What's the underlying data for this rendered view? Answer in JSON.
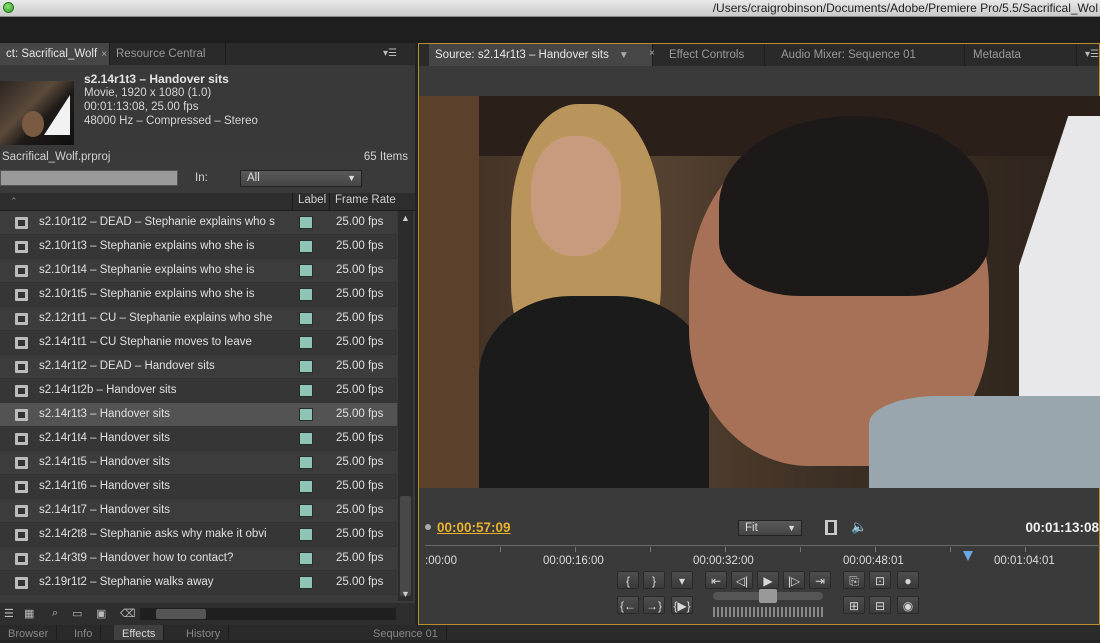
{
  "window": {
    "path": "/Users/craigrobinson/Documents/Adobe/Premiere Pro/5.5/Sacrifical_Wol"
  },
  "project_panel": {
    "tabs": [
      {
        "label": "ct: Sacrifical_Wolf",
        "active": true
      },
      {
        "label": "Resource Central",
        "active": false
      }
    ],
    "clip": {
      "name": "s2.14r1t3 – Handover sits",
      "type": "Movie, 1920 x 1080 (1.0)",
      "duration": "00:01:13:08, 25.00 fps",
      "audio": "48000 Hz – Compressed – Stereo"
    },
    "project_file": "Sacrifical_Wolf.prproj",
    "item_count": "65 Items",
    "in_label": "In:",
    "in_value": "All",
    "columns": {
      "label": "Label",
      "frame_rate": "Frame Rate"
    },
    "rows": [
      {
        "name": "s2.10r1t2 – DEAD – Stephanie explains who s",
        "fps": "25.00 fps"
      },
      {
        "name": "s2.10r1t3 – Stephanie explains who she is",
        "fps": "25.00 fps"
      },
      {
        "name": "s2.10r1t4 – Stephanie explains who she is",
        "fps": "25.00 fps"
      },
      {
        "name": "s2.10r1t5 – Stephanie explains who she is",
        "fps": "25.00 fps"
      },
      {
        "name": "s2.12r1t1 – CU – Stephanie explains who she",
        "fps": "25.00 fps"
      },
      {
        "name": "s2.14r1t1 – CU Stephanie moves to leave",
        "fps": "25.00 fps"
      },
      {
        "name": "s2.14r1t2 – DEAD – Handover sits",
        "fps": "25.00 fps"
      },
      {
        "name": "s2.14r1t2b – Handover sits",
        "fps": "25.00 fps"
      },
      {
        "name": "s2.14r1t3 – Handover sits",
        "fps": "25.00 fps",
        "selected": true
      },
      {
        "name": "s2.14r1t4 – Handover sits",
        "fps": "25.00 fps"
      },
      {
        "name": "s2.14r1t5 – Handover sits",
        "fps": "25.00 fps"
      },
      {
        "name": "s2.14r1t6 – Handover sits",
        "fps": "25.00 fps"
      },
      {
        "name": "s2.14r1t7 – Handover sits",
        "fps": "25.00 fps"
      },
      {
        "name": "s2.14r2t8 – Stephanie asks why make it obvi",
        "fps": "25.00 fps"
      },
      {
        "name": "s2.14r3t9 – Handover how to contact?",
        "fps": "25.00 fps"
      },
      {
        "name": "s2.19r1t2 – Stephanie walks away",
        "fps": "25.00 fps"
      }
    ],
    "label_color": "#8fc5b6"
  },
  "monitor": {
    "tabs": [
      {
        "label": "Source: s2.14r1t3 – Handover sits",
        "active": true
      },
      {
        "label": "Effect Controls",
        "active": false
      },
      {
        "label": "Audio Mixer: Sequence 01",
        "active": false
      },
      {
        "label": "Metadata",
        "active": false
      }
    ],
    "current_timecode": "00:00:57:09",
    "fit": "Fit",
    "duration_timecode": "00:01:13:08",
    "ruler": [
      ":00:00",
      "00:00:16:00",
      "00:00:32:00",
      "00:00:48:01",
      "00:01:04:01"
    ],
    "accent_color": "#e8b22c"
  },
  "bottom_tabs": [
    {
      "label": "Browser",
      "active": false
    },
    {
      "label": "Info",
      "active": false
    },
    {
      "label": "Effects",
      "active": true
    },
    {
      "label": "History",
      "active": false
    },
    {
      "label": "Sequence 01",
      "active": false
    }
  ]
}
